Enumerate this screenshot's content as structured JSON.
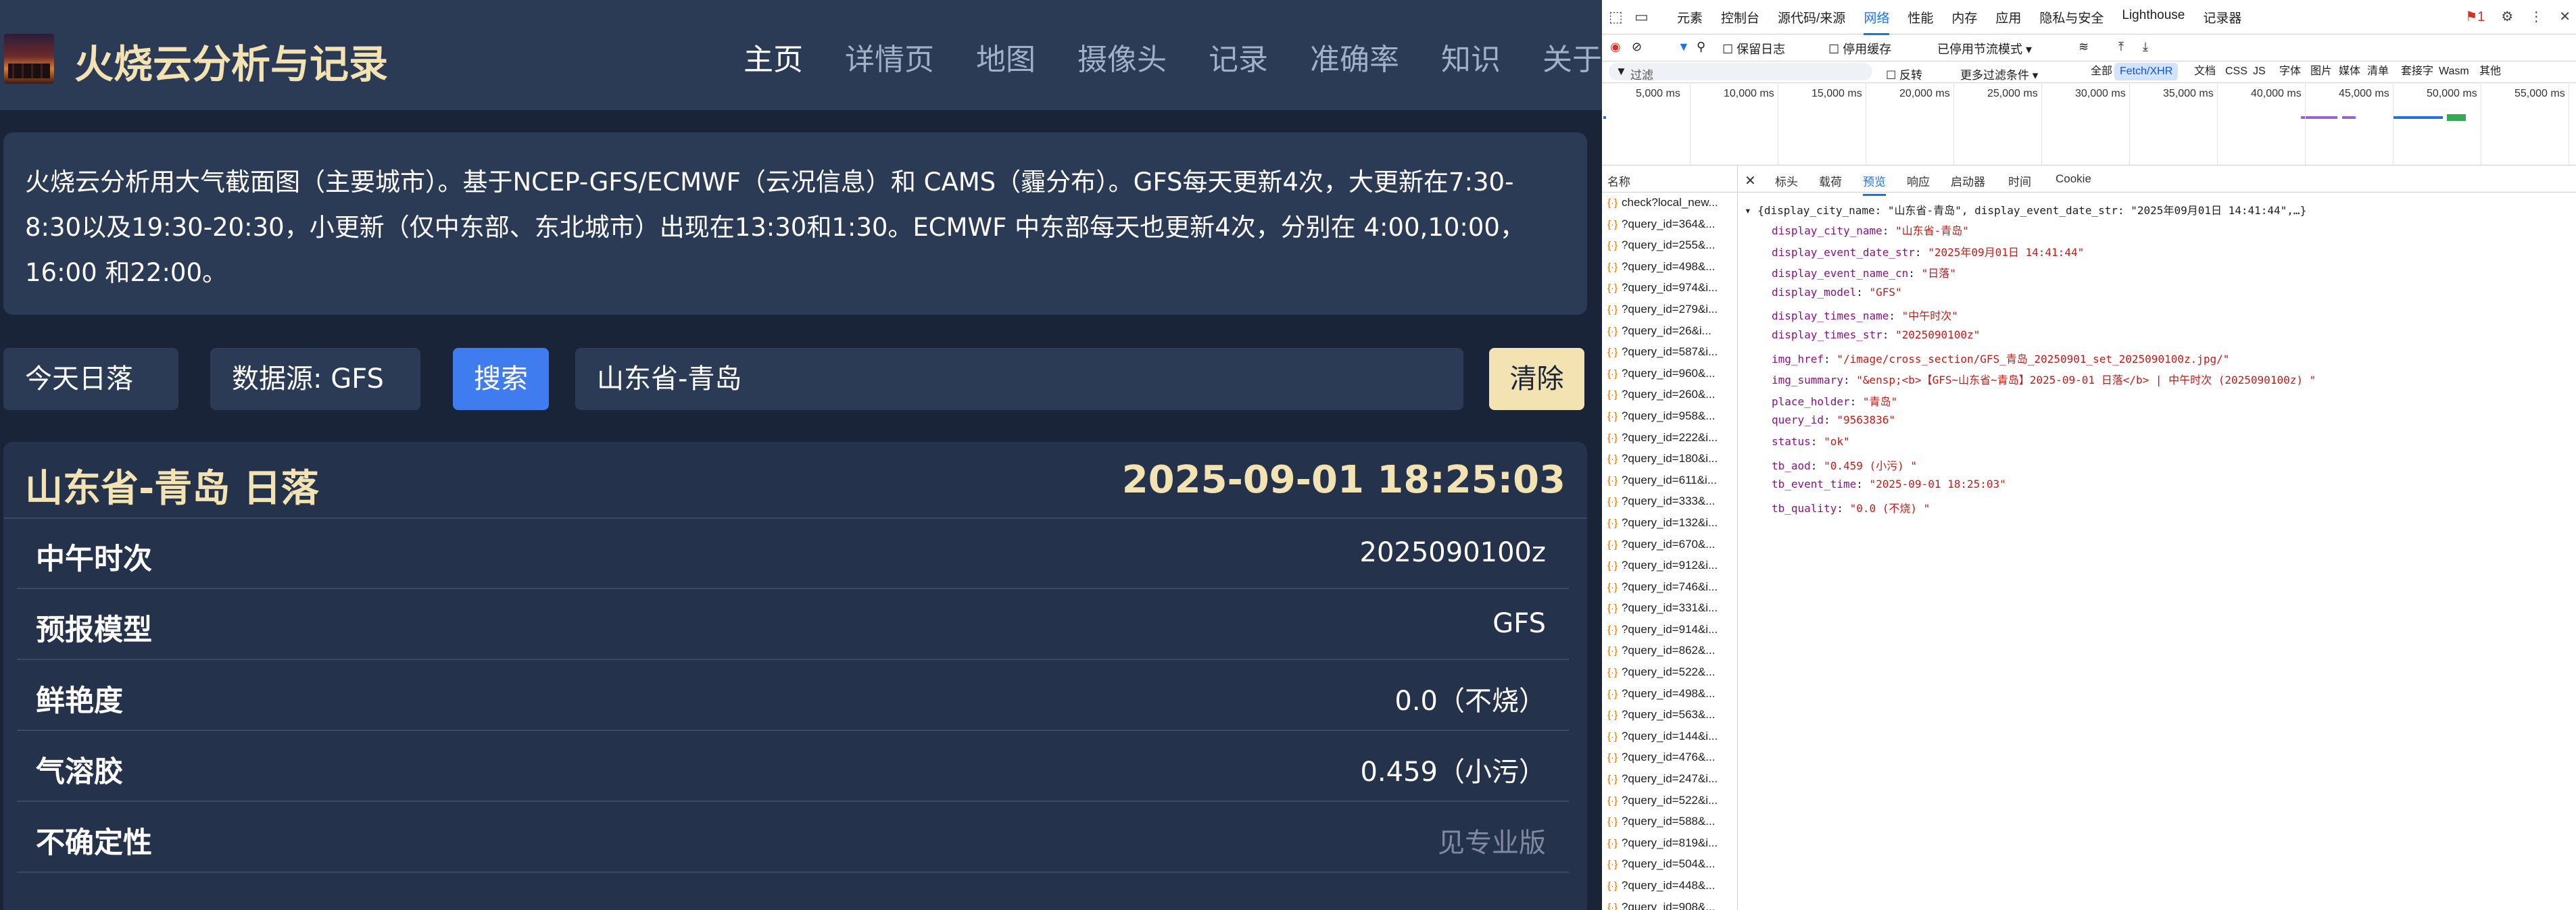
{
  "app": {
    "brand": "火烧云分析与记录",
    "nav": [
      "主页",
      "详情页",
      "地图",
      "摄像头",
      "记录",
      "准确率",
      "知识",
      "关于"
    ],
    "nav_active": "主页",
    "info_text": "火烧云分析用大气截面图（主要城市）。基于NCEP-GFS/ECMWF（云况信息）和 CAMS（霾分布）。GFS每天更新4次，大更新在7:30-8:30以及19:30-20:30，小更新（仅中东部、东北城市）出现在13:30和1:30。ECMWF 中东部每天也更新4次，分别在 4:00,10:00，16:00 和22:00。",
    "controls": {
      "date": "今天日落",
      "source": "数据源: GFS",
      "search": "搜索",
      "city": "山东省-青岛",
      "clear": "清除"
    },
    "card": {
      "title": "山东省-青岛 日落",
      "time": "2025-09-01 18:25:03",
      "rows": [
        {
          "key": "中午时次",
          "value": "2025090100z"
        },
        {
          "key": "预报模型",
          "value": "GFS"
        },
        {
          "key": "鲜艳度",
          "value": "0.0（不烧）"
        },
        {
          "key": "气溶胶",
          "value": "0.459（小污）"
        },
        {
          "key": "不确定性",
          "value": "见专业版"
        }
      ]
    }
  },
  "devtools": {
    "tabs": [
      "元素",
      "控制台",
      "源代码/来源",
      "网络",
      "性能",
      "内存",
      "应用",
      "隐私与安全",
      "Lighthouse",
      "记录器"
    ],
    "active_tab": "网络",
    "error_count": "1",
    "toolbar2": {
      "preserve_log": "保留日志",
      "disable_cache": "停用缓存",
      "throttle": "已停用节流模式"
    },
    "filter": {
      "placeholder": "过滤",
      "invert": "反转",
      "more": "更多过滤条件 ▾",
      "chips": [
        "全部",
        "Fetch/XHR",
        "文档",
        "CSS",
        "JS",
        "字体",
        "图片",
        "媒体",
        "清单",
        "套接字",
        "Wasm",
        "其他"
      ],
      "active_chip": "Fetch/XHR"
    },
    "timeline_ticks": [
      "5,000 ms",
      "10,000 ms",
      "15,000 ms",
      "20,000 ms",
      "25,000 ms",
      "30,000 ms",
      "35,000 ms",
      "40,000 ms",
      "45,000 ms",
      "50,000 ms",
      "55,000 ms"
    ],
    "list_header": "名称",
    "requests": [
      "check?local_new...",
      "?query_id=364&...",
      "?query_id=255&...",
      "?query_id=498&...",
      "?query_id=974&i...",
      "?query_id=279&i...",
      "?query_id=26&i...",
      "?query_id=587&i...",
      "?query_id=960&...",
      "?query_id=260&...",
      "?query_id=958&...",
      "?query_id=222&i...",
      "?query_id=180&i...",
      "?query_id=611&i...",
      "?query_id=333&...",
      "?query_id=132&i...",
      "?query_id=670&...",
      "?query_id=912&i...",
      "?query_id=746&i...",
      "?query_id=331&i...",
      "?query_id=914&i...",
      "?query_id=862&...",
      "?query_id=522&...",
      "?query_id=498&...",
      "?query_id=563&...",
      "?query_id=144&i...",
      "?query_id=476&...",
      "?query_id=247&i...",
      "?query_id=522&i...",
      "?query_id=588&...",
      "?query_id=819&i...",
      "?query_id=504&...",
      "?query_id=448&...",
      "?query_id=908&..."
    ],
    "detail_tabs": [
      "标头",
      "载荷",
      "预览",
      "响应",
      "启动器",
      "时间",
      "Cookie"
    ],
    "active_detail_tab": "预览",
    "preview_summary": "▾ {display_city_name: \"山东省-青岛\", display_event_date_str: \"2025年09月01日 14:41:44\",…}",
    "preview": [
      {
        "k": "display_city_name",
        "v": "\"山东省-青岛\""
      },
      {
        "k": "display_event_date_str",
        "v": "\"2025年09月01日 14:41:44\""
      },
      {
        "k": "display_event_name_cn",
        "v": "\"日落\""
      },
      {
        "k": "display_model",
        "v": "\"GFS\""
      },
      {
        "k": "display_times_name",
        "v": "\"中午时次\""
      },
      {
        "k": "display_times_str",
        "v": "\"2025090100z\""
      },
      {
        "k": "img_href",
        "v": "\"/image/cross_section/GFS_青岛_20250901_set_2025090100z.jpg/\""
      },
      {
        "k": "img_summary",
        "v": "\"&ensp;<b>【GFS~山东省~青岛】2025-09-01 日落</b> | 中午时次 (2025090100z) \""
      },
      {
        "k": "place_holder",
        "v": "\"青岛\""
      },
      {
        "k": "query_id",
        "v": "\"9563836\""
      },
      {
        "k": "status",
        "v": "\"ok\""
      },
      {
        "k": "tb_aod",
        "v": "\"0.459 (小污) \""
      },
      {
        "k": "tb_event_time",
        "v": "\"2025-09-01 18:25:03\""
      },
      {
        "k": "tb_quality",
        "v": "\"0.0 (不烧) \""
      }
    ]
  }
}
